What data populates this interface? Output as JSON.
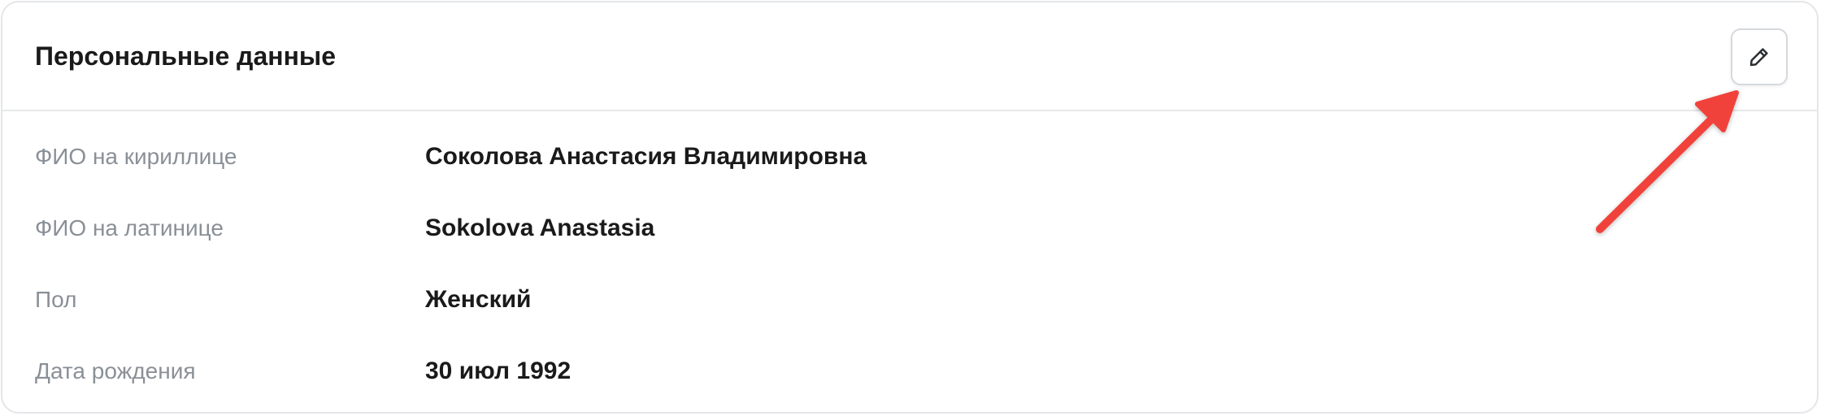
{
  "card": {
    "title": "Персональные данные"
  },
  "rows": [
    {
      "label": "ФИО на кириллице",
      "value": "Соколова Анастасия Владимировна"
    },
    {
      "label": "ФИО на латинице",
      "value": "Sokolova Anastasia"
    },
    {
      "label": "Пол",
      "value": "Женский"
    },
    {
      "label": "Дата рождения",
      "value": "30 июл 1992"
    }
  ],
  "icons": {
    "edit": "pencil-icon"
  },
  "colors": {
    "annotation_arrow": "#f0433a",
    "label": "#8a9097",
    "value": "#1a1a1a"
  }
}
